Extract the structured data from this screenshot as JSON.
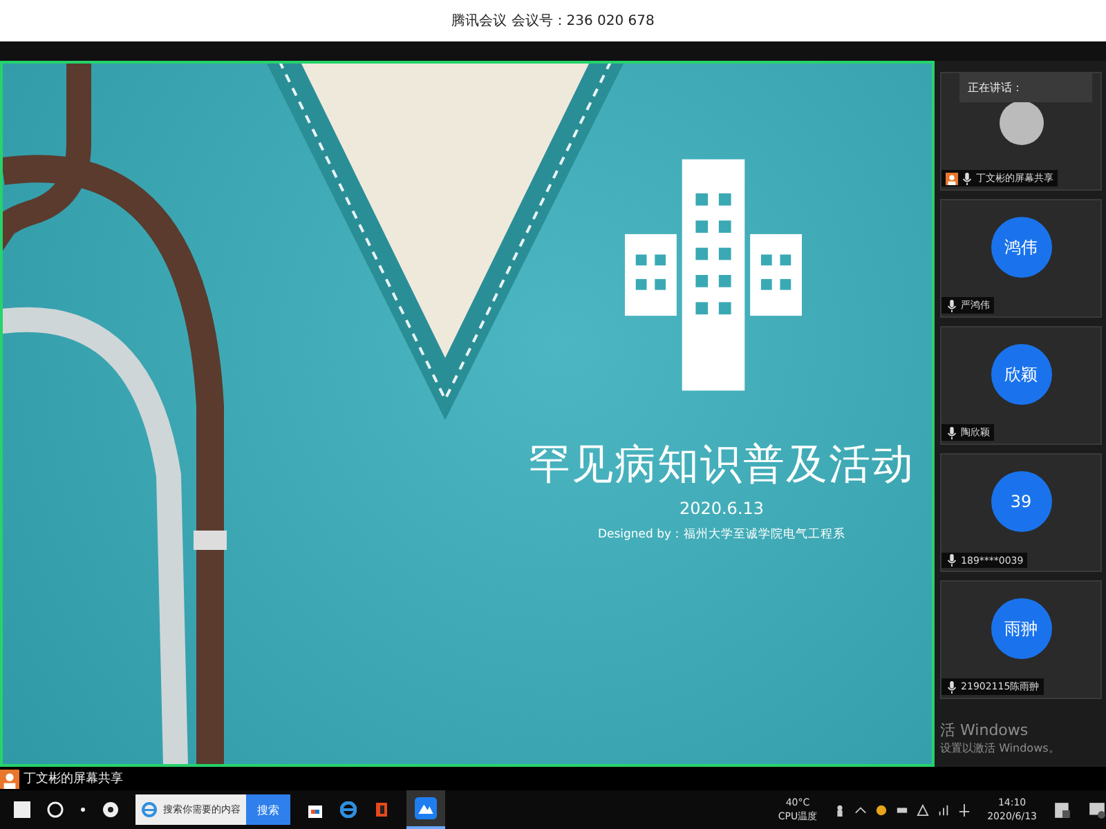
{
  "window": {
    "title": "腾讯会议 会议号：236 020 678"
  },
  "slide": {
    "title": "罕见病知识普及活动",
    "date": "2020.6.13",
    "credit": "Designed by：福州大学至诚学院电气工程系"
  },
  "speaking": {
    "label": "正在讲话："
  },
  "participants": [
    {
      "kind": "photo",
      "name": "丁文彬的屏幕共享"
    },
    {
      "kind": "initials",
      "avatar": "鸿伟",
      "name": "严鸿伟"
    },
    {
      "kind": "initials",
      "avatar": "欣颖",
      "name": "陶欣颖"
    },
    {
      "kind": "initials",
      "avatar": "39",
      "name": "189****0039"
    },
    {
      "kind": "initials",
      "avatar": "雨翀",
      "name": "21902115陈雨翀"
    }
  ],
  "activation": {
    "line_1": "活 Windows",
    "line_2": "设置以激活 Windows。"
  },
  "share_label": "丁文彬的屏幕共享",
  "taskbar": {
    "search": {
      "placeholder": "搜索你需要的内容",
      "button": "搜索"
    },
    "temperature": "40°C",
    "temperature_label": "CPU温度",
    "time": "14:10",
    "date": "2020/6/13"
  }
}
